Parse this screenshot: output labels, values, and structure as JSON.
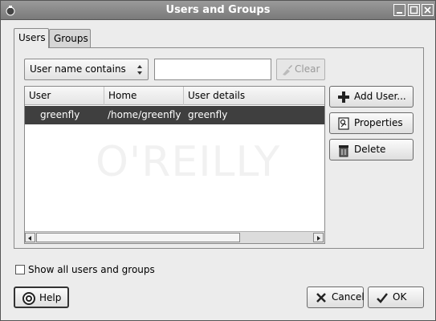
{
  "window": {
    "title": "Users and Groups"
  },
  "tabs": [
    {
      "label": "Users",
      "active": true
    },
    {
      "label": "Groups",
      "active": false
    }
  ],
  "filter": {
    "selected": "User name contains",
    "search_value": "",
    "clear_label": "Clear"
  },
  "table": {
    "columns": [
      "User",
      "Home",
      "User details"
    ],
    "rows": [
      {
        "user": "greenfly",
        "home": "/home/greenfly",
        "details": "greenfly",
        "selected": true
      }
    ],
    "watermark": "O'REILLY"
  },
  "side_buttons": {
    "add_user": "Add User...",
    "properties": "Properties",
    "delete": "Delete"
  },
  "show_all": {
    "label": "Show all users and groups",
    "checked": false
  },
  "footer": {
    "help": "Help",
    "cancel": "Cancel",
    "ok": "OK"
  },
  "colors": {
    "titlebar": "#8a8a8a",
    "selection": "#3f3f3f",
    "background": "#ececec"
  },
  "icons": [
    "window-menu-icon",
    "minimize-icon",
    "maximize-icon",
    "close-icon",
    "clear-brush-icon",
    "add-user-icon",
    "properties-icon",
    "trash-icon",
    "help-icon",
    "cancel-x-icon",
    "ok-check-icon"
  ]
}
